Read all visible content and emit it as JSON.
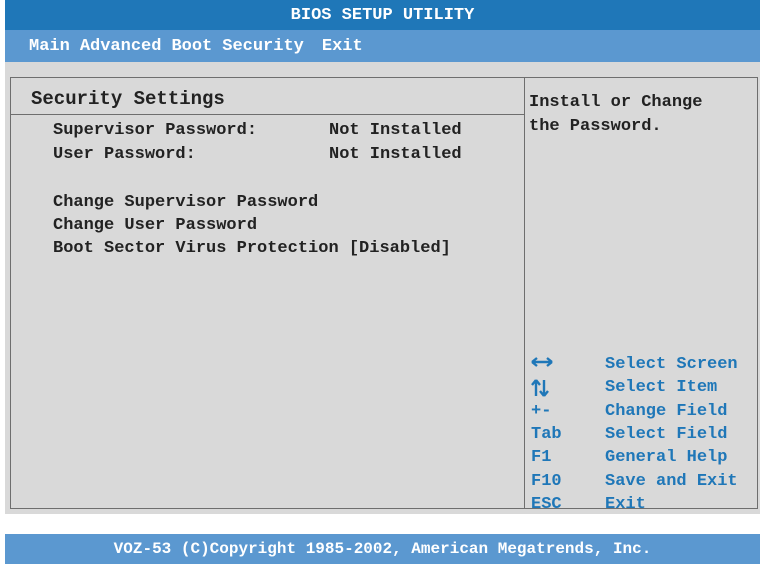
{
  "title": "BIOS SETUP UTILITY",
  "menu": [
    "Main",
    "Advanced",
    "Boot",
    "Security",
    "Exit"
  ],
  "section_title": "Security Settings",
  "status": [
    {
      "label": "Supervisor Password:",
      "value": "Not Installed"
    },
    {
      "label": "User Password:",
      "value": "Not Installed"
    }
  ],
  "options": [
    "Change Supervisor Password",
    "Change User Password",
    "Boot Sector Virus Protection [Disabled]"
  ],
  "help_text": [
    "Install or Change",
    "the Password."
  ],
  "keys": [
    {
      "key_icon": "left-right-arrow-icon",
      "desc": "Select Screen"
    },
    {
      "key_icon": "up-down-arrow-icon",
      "desc": "Select Item"
    },
    {
      "key": "+-",
      "desc": "Change Field"
    },
    {
      "key": "Tab",
      "desc": "Select Field"
    },
    {
      "key": "F1",
      "desc": "General Help"
    },
    {
      "key": "F10",
      "desc": "Save and Exit"
    },
    {
      "key": "ESC",
      "desc": "Exit"
    }
  ],
  "footer": "VOZ-53 (C)Copyright 1985-2002, American Megatrends, Inc.",
  "colors": {
    "title_bar": "#1f77b8",
    "menu_bar": "#5b98d0",
    "panel": "#d9d9d9",
    "key_text": "#1f77b8"
  }
}
